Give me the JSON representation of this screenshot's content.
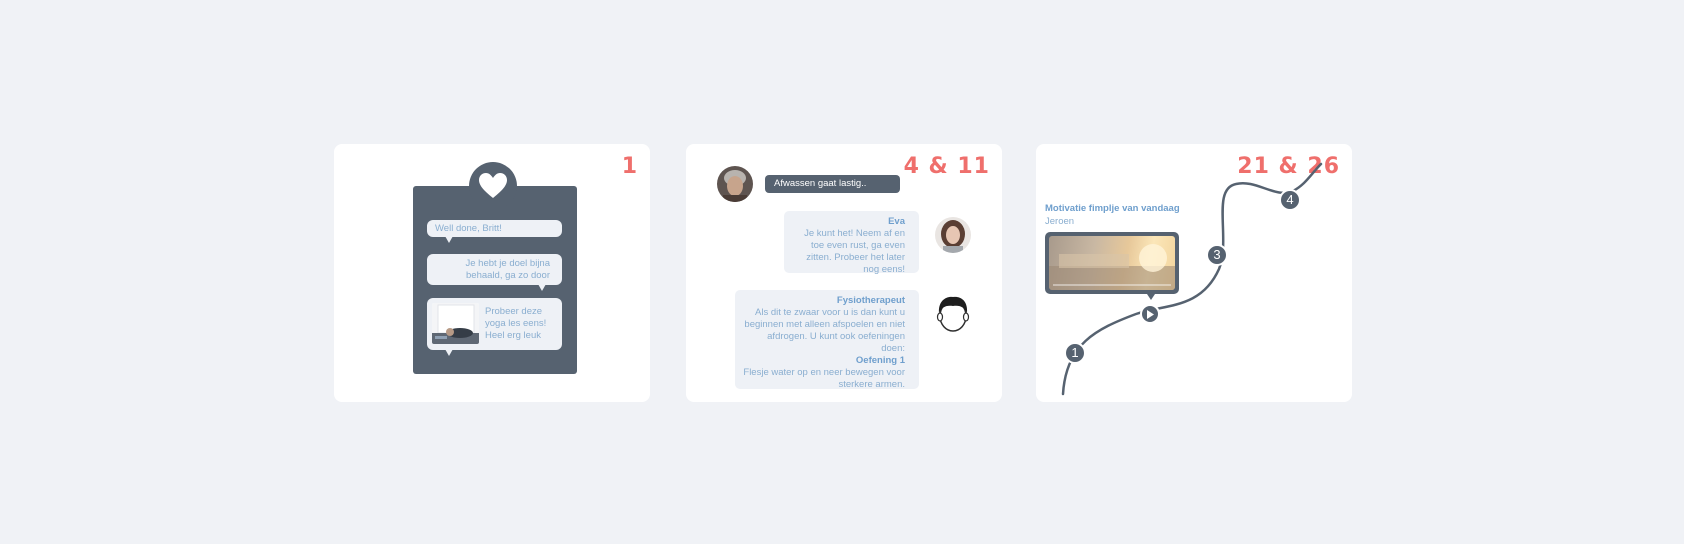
{
  "cards": [
    {
      "number": "1",
      "messages": {
        "m1": "Well done, Britt!",
        "m2": "Je hebt je doel bijna behaald, ga zo door",
        "m3": "Probeer deze yoga les eens! Heel erg leuk"
      }
    },
    {
      "number": "4 & 11",
      "user_message": "Afwassen gaat lastig..",
      "eva": {
        "name": "Eva",
        "text": "Je kunt het! Neem af en toe even rust, ga even zitten. Probeer het later nog eens!"
      },
      "fysio": {
        "name": "Fysiotherapeut",
        "text": "Als dit te zwaar voor u is dan kunt u beginnen met alleen afspoelen en niet afdrogen. U kunt ook oefeningen doen:",
        "exercise_title": "Oefening 1",
        "exercise_text": "Flesje water op en neer bewegen voor sterkere armen."
      }
    },
    {
      "number": "21 & 26",
      "video_title": "Motivatie fimplje van vandaag",
      "video_author": "Jeroen",
      "path_steps": [
        "1",
        "3",
        "4"
      ]
    }
  ],
  "colors": {
    "accent": "#ef6f6c",
    "dark": "#566270",
    "bubble": "#eef1f6",
    "text_blue": "#8aaed0"
  }
}
